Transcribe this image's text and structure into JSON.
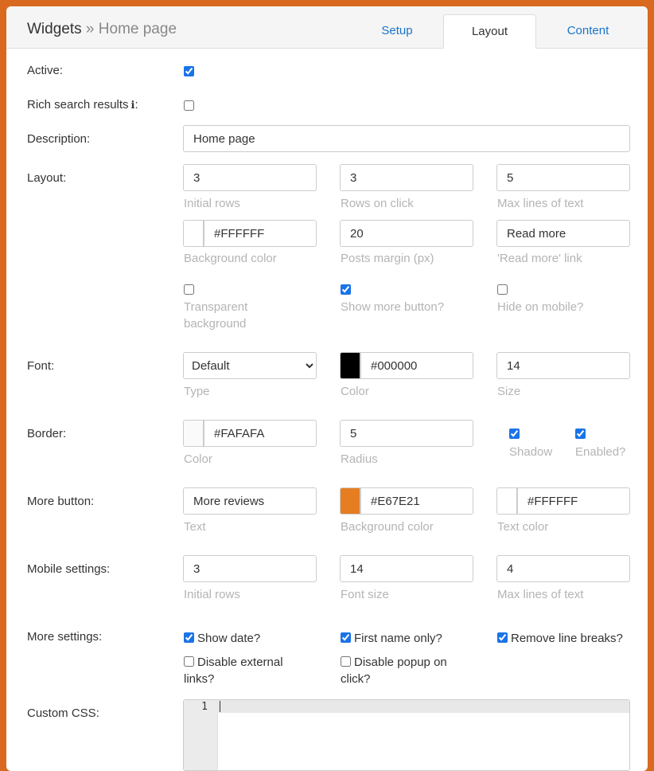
{
  "breadcrumb": {
    "root": "Widgets",
    "separator": "»",
    "current": "Home page"
  },
  "tabs": {
    "setup": "Setup",
    "layout": "Layout",
    "content": "Content"
  },
  "labels": {
    "active": "Active:",
    "rich": "Rich search results",
    "rich_colon": ":",
    "description": "Description:",
    "layout": "Layout:",
    "font": "Font:",
    "border": "Border:",
    "more_button": "More button:",
    "mobile": "Mobile settings:",
    "more_settings": "More settings:",
    "custom_css": "Custom CSS:"
  },
  "info_icon": "ℹ",
  "active": {
    "checked": true
  },
  "rich": {
    "checked": false
  },
  "description": {
    "value": "Home page"
  },
  "layout": {
    "initial_rows": {
      "value": "3",
      "help": "Initial rows"
    },
    "rows_on_click": {
      "value": "3",
      "help": "Rows on click"
    },
    "max_lines": {
      "value": "5",
      "help": "Max lines of text"
    },
    "bg_color": {
      "value": "#FFFFFF",
      "swatch": "#FFFFFF",
      "help": "Background color"
    },
    "posts_margin": {
      "value": "20",
      "help": "Posts margin (px)"
    },
    "read_more": {
      "value": "Read more",
      "help": "'Read more' link"
    },
    "transparent": {
      "checked": false,
      "help_line1": "Transparent",
      "help_line2": "background"
    },
    "show_more": {
      "checked": true,
      "help": "Show more button?"
    },
    "hide_mobile": {
      "checked": false,
      "help": "Hide on mobile?"
    }
  },
  "font": {
    "type": {
      "value": "Default",
      "help": "Type"
    },
    "color": {
      "value": "#000000",
      "swatch": "#000000",
      "help": "Color"
    },
    "size": {
      "value": "14",
      "help": "Size"
    }
  },
  "border": {
    "color": {
      "value": "#FAFAFA",
      "swatch": "#FAFAFA",
      "help": "Color"
    },
    "radius": {
      "value": "5",
      "help": "Radius"
    },
    "shadow": {
      "checked": true,
      "help": "Shadow"
    },
    "enabled": {
      "checked": true,
      "help": "Enabled?"
    }
  },
  "more_button": {
    "text": {
      "value": "More reviews",
      "help": "Text"
    },
    "bg": {
      "value": "#E67E21",
      "swatch": "#E67E21",
      "help": "Background color"
    },
    "text_color": {
      "value": "#FFFFFF",
      "swatch": "#FFFFFF",
      "help": "Text color"
    }
  },
  "mobile": {
    "initial_rows": {
      "value": "3",
      "help": "Initial rows"
    },
    "font_size": {
      "value": "14",
      "help": "Font size"
    },
    "max_lines": {
      "value": "4",
      "help": "Max lines of text"
    }
  },
  "more_settings": {
    "show_date": {
      "checked": true,
      "label": "Show date?"
    },
    "first_name": {
      "checked": true,
      "label": "First name only?"
    },
    "remove_breaks": {
      "checked": true,
      "label": "Remove line breaks?"
    },
    "disable_links": {
      "checked": false,
      "label_line1": "Disable external",
      "label_line2": "links?"
    },
    "disable_popup": {
      "checked": false,
      "label_line1": "Disable popup on",
      "label_line2": "click?"
    }
  },
  "custom_css": {
    "line_number": "1",
    "value": ""
  }
}
